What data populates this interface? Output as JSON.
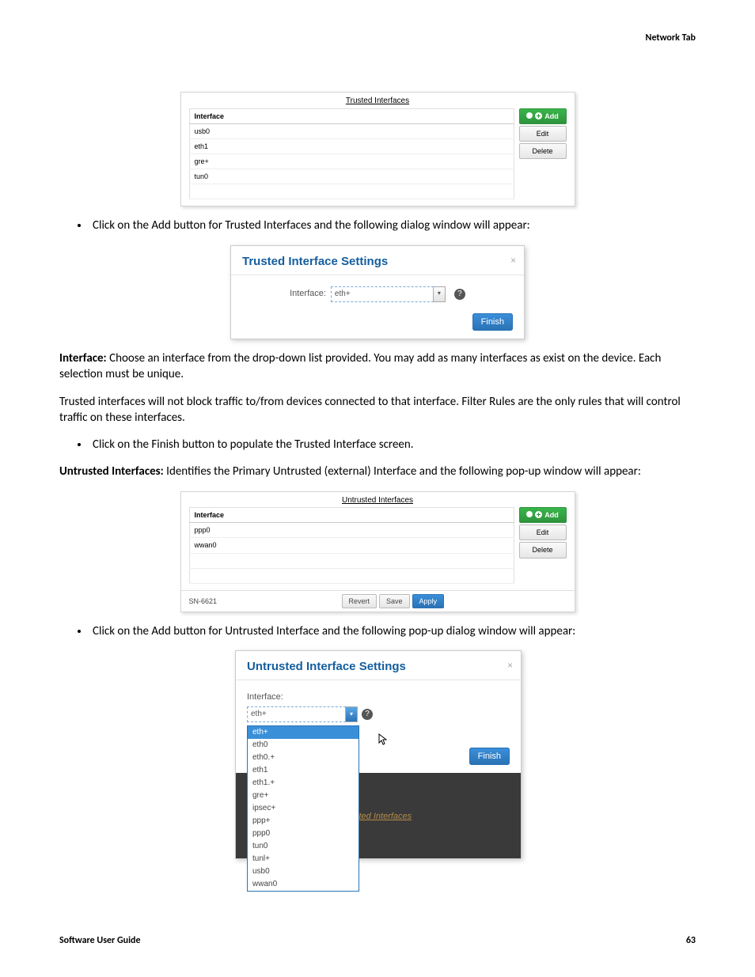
{
  "header": {
    "right": "Network Tab"
  },
  "footer": {
    "left": "Software User Guide",
    "page": "63"
  },
  "trusted_panel": {
    "title": "Trusted Interfaces",
    "col_header": "Interface",
    "rows": [
      "usb0",
      "eth1",
      "gre+",
      "tun0"
    ],
    "buttons": {
      "add": "Add",
      "edit": "Edit",
      "del": "Delete"
    }
  },
  "bullet1": "Click on the Add button for Trusted Interfaces and the following dialog window will appear:",
  "trusted_dialog": {
    "title": "Trusted Interface Settings",
    "label": "Interface:",
    "value": "eth+",
    "finish": "Finish"
  },
  "para_interface_bold": "Interface:",
  "para_interface": " Choose an interface from the drop-down list provided. You may add as many interfaces as exist on the device. Each selection must be unique.",
  "para_trusted_note": "Trusted interfaces will not block traffic to/from devices connected to that interface. Filter Rules are the only rules that will control traffic on these interfaces.",
  "bullet2": "Click on the Finish button to populate the Trusted Interface screen.",
  "para_untrusted_bold": "Untrusted Interfaces:",
  "para_untrusted": " Identifies the Primary Untrusted (external) Interface and the following pop-up window will appear:",
  "untrusted_panel": {
    "title": "Untrusted Interfaces",
    "col_header": "Interface",
    "rows": [
      "ppp0",
      "wwan0"
    ],
    "buttons": {
      "add": "Add",
      "edit": "Edit",
      "del": "Delete"
    },
    "device": "SN-6621",
    "footer_btns": {
      "revert": "Revert",
      "save": "Save",
      "apply": "Apply"
    }
  },
  "bullet3": "Click on the Add button for Untrusted Interface and the following pop-up dialog window will appear:",
  "untrusted_dialog": {
    "title": "Untrusted Interface Settings",
    "label": "Interface:",
    "value": "eth+",
    "finish": "Finish",
    "options": [
      "eth+",
      "eth0",
      "eth0.+",
      "eth1",
      "eth1.+",
      "gre+",
      "ipsec+",
      "ppp+",
      "ppp0",
      "tun0",
      "tunl+",
      "usb0",
      "wwan0"
    ],
    "faded_caption": "sted Interfaces"
  }
}
